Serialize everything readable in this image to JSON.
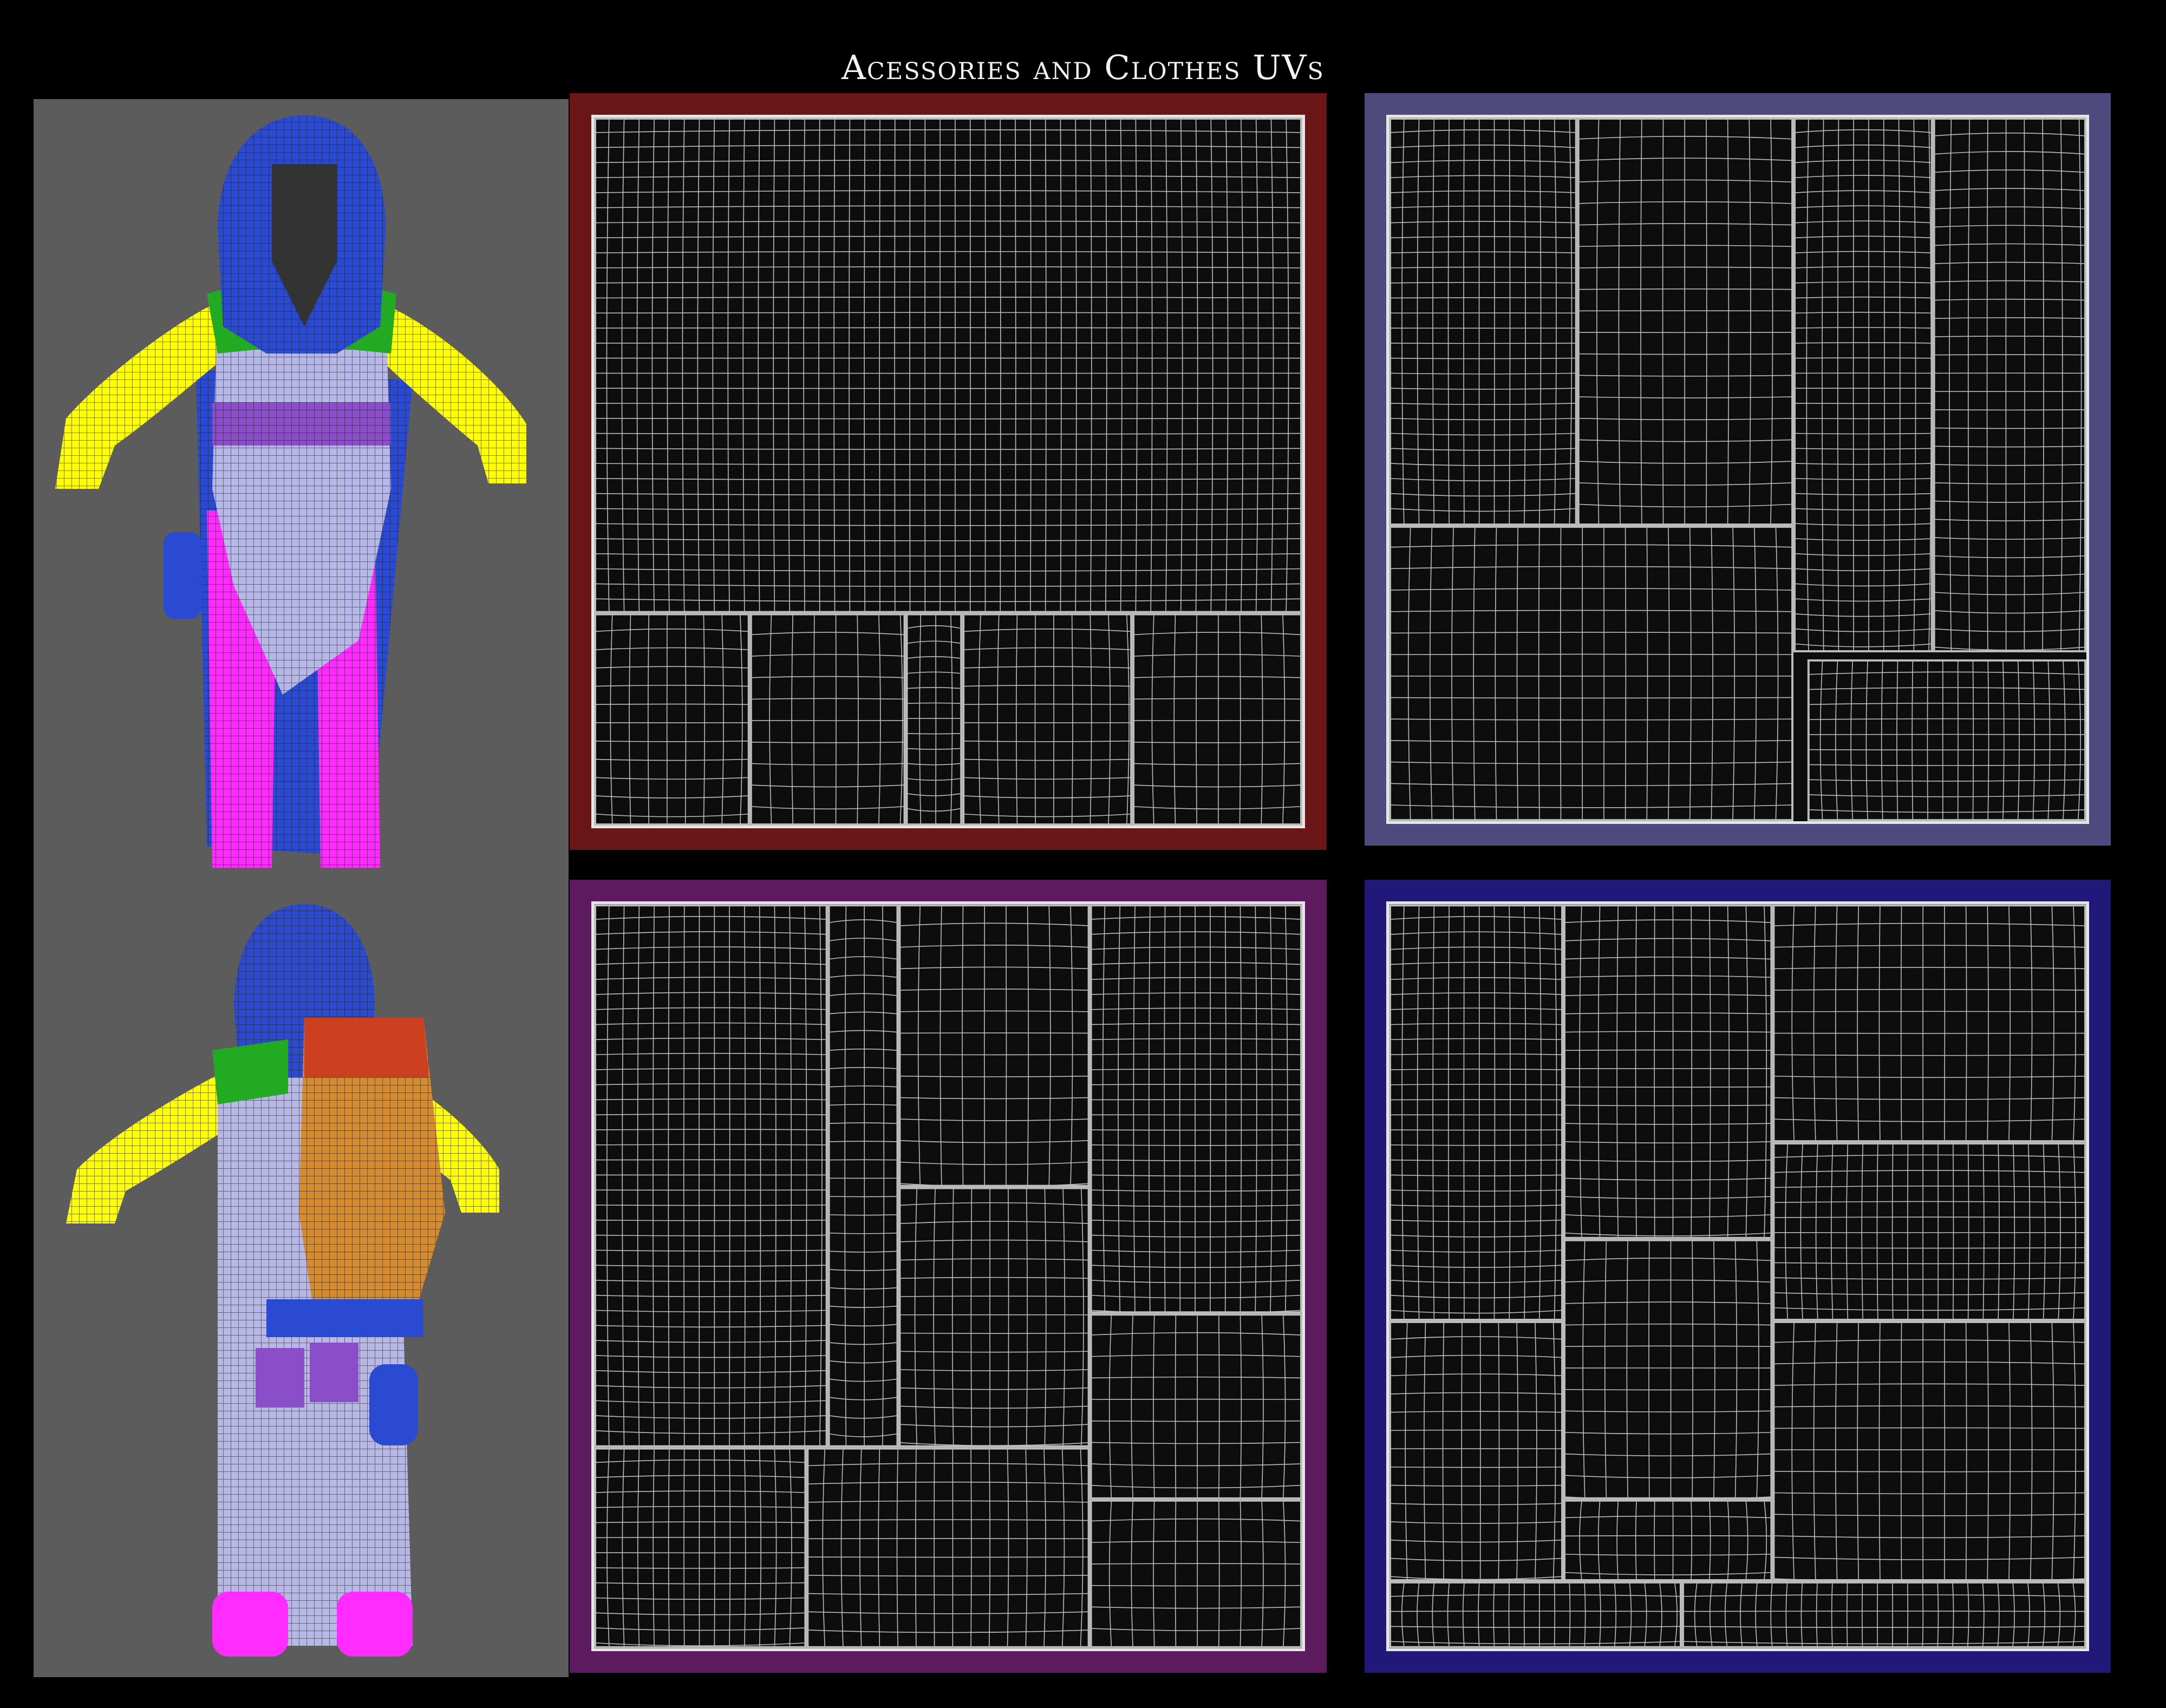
{
  "title": "Acessories and Clothes UVs",
  "colors": {
    "background": "#000000",
    "model_panel": "#5c5c5c",
    "frame_red": "#6b1616",
    "frame_lavender": "#4f4a7d",
    "frame_purple": "#5e1a5e",
    "frame_indigo": "#22187a",
    "uv_background": "#0d0d0d",
    "uv_lines": "#e8e8e8",
    "wire_hood": "#2a4bd1",
    "wire_arms": "#ffff00",
    "wire_shoulders": "#22aa22",
    "wire_pants": "#ff2bff",
    "wire_belt": "#8a4fc8",
    "wire_backpack": "#d98a2a",
    "wire_tunic": "#b8b8e8"
  },
  "views": [
    {
      "name": "front-view"
    },
    {
      "name": "back-view"
    }
  ],
  "uv_sheets": [
    {
      "name": "uv-sheet-cloak",
      "frame_color": "#6b1616"
    },
    {
      "name": "uv-sheet-tunic",
      "frame_color": "#4f4a7d"
    },
    {
      "name": "uv-sheet-pants-boots",
      "frame_color": "#5e1a5e"
    },
    {
      "name": "uv-sheet-accessories",
      "frame_color": "#22187a"
    }
  ]
}
